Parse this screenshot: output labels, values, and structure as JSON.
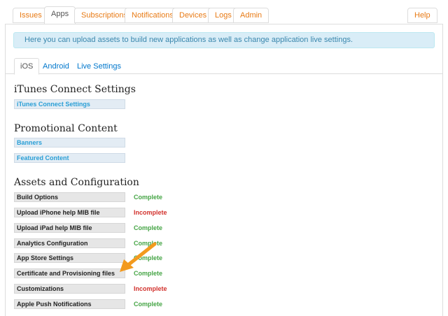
{
  "top_tabs": {
    "issues": "Issues",
    "apps": "Apps",
    "subscriptions": "Subscriptions",
    "notifications": "Notifications",
    "devices": "Devices",
    "logs": "Logs",
    "admin": "Admin",
    "help": "Help"
  },
  "info_message": "Here you can upload assets to build new applications as well as change application live settings.",
  "sub_tabs": {
    "ios": "iOS",
    "android": "Android",
    "live_settings": "Live Settings"
  },
  "itunes": {
    "title": "iTunes Connect Settings",
    "link": "iTunes Connect Settings"
  },
  "promo": {
    "title": "Promotional Content",
    "banners": "Banners",
    "featured": "Featured Content"
  },
  "assets": {
    "title": "Assets and Configuration",
    "rows": [
      {
        "label": "Build Options",
        "status": "Complete"
      },
      {
        "label": "Upload iPhone help MIB file",
        "status": "Incomplete"
      },
      {
        "label": "Upload iPad help MIB file",
        "status": "Complete"
      },
      {
        "label": "Analytics Configuration",
        "status": "Complete"
      },
      {
        "label": "App Store Settings",
        "status": "Complete"
      },
      {
        "label": "Certificate and Provisioning files",
        "status": "Complete"
      },
      {
        "label": "Customizations",
        "status": "Incomplete"
      },
      {
        "label": "Apple Push Notifications",
        "status": "Complete"
      }
    ]
  },
  "colors": {
    "accent_orange": "#e87a14",
    "link_blue": "#2a9fd6",
    "complete_green": "#46a546",
    "incomplete_red": "#d2322d",
    "info_bg": "#d9edf7"
  },
  "icons": {
    "annotation": "arrow-icon"
  }
}
